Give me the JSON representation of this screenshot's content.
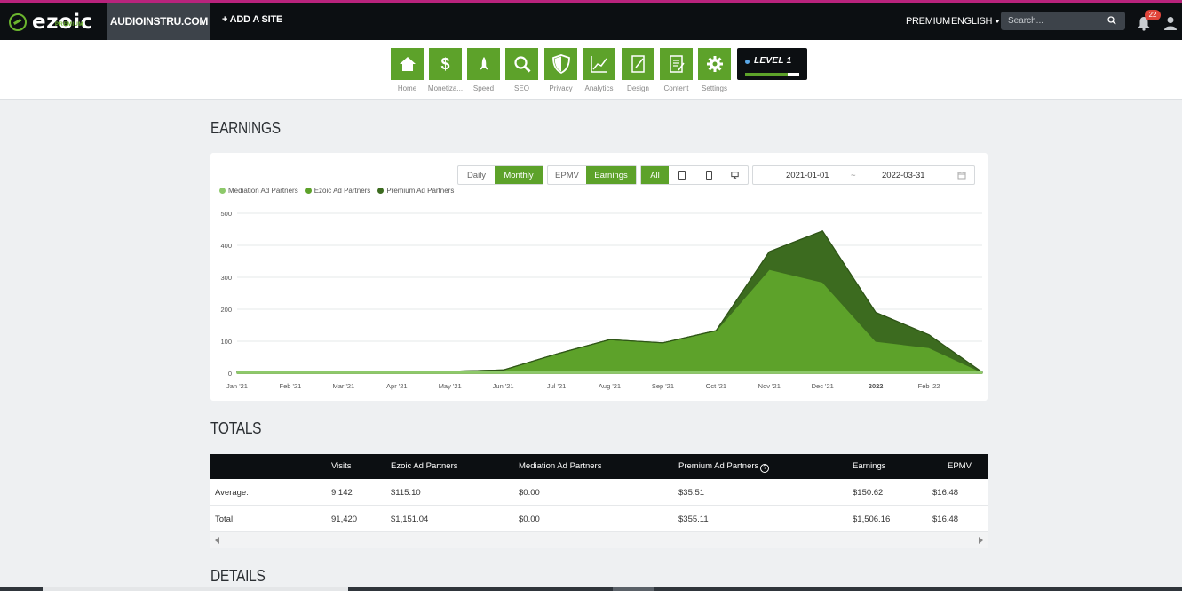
{
  "nav": {
    "logo": "ezoic",
    "logo_sub": "PREMIUM",
    "site": "AUDIOINSTRU.COM",
    "add_site": "+ ADD A SITE",
    "premium": "PREMIUM",
    "language": "ENGLISH",
    "search_placeholder": "Search...",
    "notifications": "22"
  },
  "toolbar": {
    "items": [
      {
        "label": "Home",
        "icon": "home-icon"
      },
      {
        "label": "Monetiza...",
        "icon": "dollar-icon"
      },
      {
        "label": "Speed",
        "icon": "rocket-icon"
      },
      {
        "label": "SEO",
        "icon": "magnifier-icon"
      },
      {
        "label": "Privacy",
        "icon": "shield-icon"
      },
      {
        "label": "Analytics",
        "icon": "chart-icon"
      },
      {
        "label": "Design",
        "icon": "design-icon"
      },
      {
        "label": "Content",
        "icon": "document-icon"
      },
      {
        "label": "Settings",
        "icon": "gear-icon"
      }
    ],
    "level": "LEVEL 1",
    "level_progress": 0.78
  },
  "earnings": {
    "title": "EARNINGS",
    "period_buttons": [
      "Daily",
      "Monthly"
    ],
    "period_active": "Monthly",
    "metric_buttons": [
      "EPMV",
      "Earnings"
    ],
    "metric_active": "Earnings",
    "device_all": "All",
    "device_icons": [
      "tablet-icon",
      "mobile-icon",
      "desktop-icon"
    ],
    "date_from": "2021-01-01",
    "date_sep": "~",
    "date_to": "2022-03-31"
  },
  "chart_data": {
    "type": "area",
    "stacked": true,
    "x": [
      "Jan '21",
      "Feb '21",
      "Mar '21",
      "Apr '21",
      "May '21",
      "Jun '21",
      "Jul '21",
      "Aug '21",
      "Sep '21",
      "Oct '21",
      "Nov '21",
      "Dec '21",
      "2022",
      "Feb '22",
      "Mar '22"
    ],
    "x_tick_labels": [
      "Jan '21",
      "Feb '21",
      "Mar '21",
      "Apr '21",
      "May '21",
      "Jun '21",
      "Jul '21",
      "Aug '21",
      "Sep '21",
      "Oct '21",
      "Nov '21",
      "Dec '21",
      "2022",
      "Feb '22",
      ""
    ],
    "yticks": [
      0,
      100,
      200,
      300,
      400,
      500
    ],
    "ylim": [
      0,
      500
    ],
    "grid": true,
    "legend_position": "top-left",
    "series": [
      {
        "name": "Mediation Ad Partners",
        "color": "#8dc96a",
        "values": [
          0,
          0,
          0,
          0,
          0,
          0,
          0,
          0,
          0,
          0,
          0,
          0,
          0,
          0,
          0
        ]
      },
      {
        "name": "Ezoic Ad Partners",
        "color": "#5da22a",
        "values": [
          4,
          5,
          5,
          6,
          6,
          10,
          60,
          105,
          95,
          133,
          325,
          285,
          100,
          80,
          3
        ]
      },
      {
        "name": "Premium Ad Partners",
        "color": "#3c6b1f",
        "values": [
          0,
          0,
          0,
          0,
          0,
          0,
          0,
          0,
          0,
          0,
          55,
          160,
          90,
          40,
          0
        ]
      }
    ]
  },
  "totals": {
    "title": "TOTALS",
    "headers": [
      "Visits",
      "Ezoic Ad Partners",
      "Mediation Ad Partners",
      "Premium Ad Partners",
      "Earnings",
      "EPMV"
    ],
    "rows": [
      {
        "label": "Average:",
        "cells": [
          "9,142",
          "$115.10",
          "$0.00",
          "$35.51",
          "$150.62",
          "$16.48"
        ]
      },
      {
        "label": "Total:",
        "cells": [
          "91,420",
          "$1,151.04",
          "$0.00",
          "$355.11",
          "$1,506.16",
          "$16.48"
        ]
      }
    ]
  },
  "details": {
    "title": "DETAILS"
  }
}
